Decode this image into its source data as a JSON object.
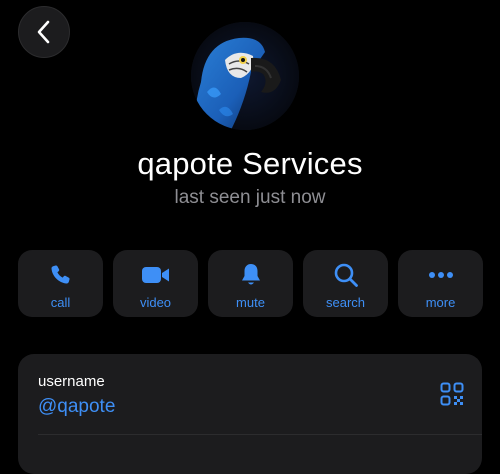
{
  "profile": {
    "name": "qapote Services",
    "status": "last seen just now"
  },
  "actions": [
    {
      "label": "call",
      "icon": "phone-icon"
    },
    {
      "label": "video",
      "icon": "video-icon"
    },
    {
      "label": "mute",
      "icon": "bell-icon"
    },
    {
      "label": "search",
      "icon": "search-icon"
    },
    {
      "label": "more",
      "icon": "ellipsis-icon"
    }
  ],
  "info": {
    "username_label": "username",
    "username_value": "@qapote"
  },
  "colors": {
    "accent": "#3e8ff6",
    "background": "#000000",
    "surface": "#1c1c1e",
    "secondary_text": "#8e8e93"
  }
}
